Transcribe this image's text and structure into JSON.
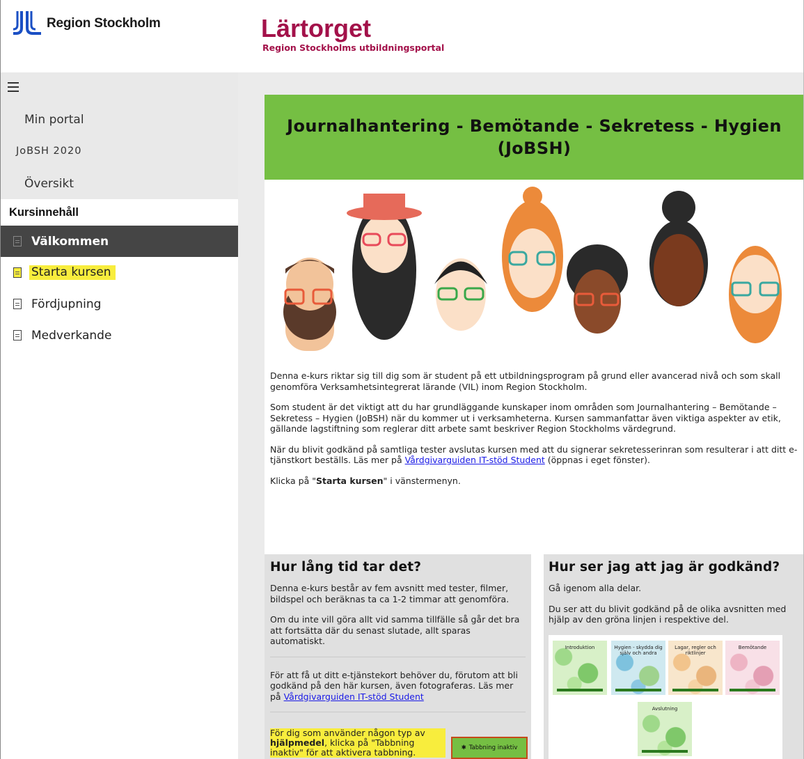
{
  "header": {
    "org_name": "Region Stockholm",
    "brand_title": "Lärtorget",
    "brand_subtitle": "Region Stockholms utbildningsportal"
  },
  "sidebar": {
    "links": {
      "portal": "Min portal",
      "course": "JoBSH 2020",
      "overview": "Översikt"
    },
    "section_title": "Kursinnehåll",
    "items": [
      {
        "label": "Välkommen",
        "state": "active"
      },
      {
        "label": "Starta kursen",
        "state": "highlighted"
      },
      {
        "label": "Fördjupning",
        "state": "normal"
      },
      {
        "label": "Medverkande",
        "state": "normal"
      }
    ]
  },
  "main": {
    "banner_title": "Journalhantering - Bemötande - Sekretess - Hygien (JoBSH)",
    "intro": {
      "p1": "Denna e-kurs riktar sig till dig som är student på ett utbildningsprogram på grund eller avancerad nivå och som skall genomföra Verksamhetsintegrerat lärande (VIL) inom Region Stockholm.",
      "p2": "Som student är det viktigt att du har grundläggande kunskaper inom områden som Journalhantering – Bemötande – Sekretess – Hygien (JoBSH) när du kommer ut i verksamheterna. Kursen sammanfattar även viktiga aspekter av etik, gällande lagstiftning som reglerar ditt arbete samt beskriver Region Stockholms värdegrund.",
      "p3_before": "När du blivit godkänd på samtliga tester avslutas kursen med att du signerar sekretesserinran som resulterar i att ditt e-tjänstkort beställs. Läs mer på ",
      "p3_link": "Vårdgivarguiden IT-stöd Student",
      "p3_after": " (öppnas i eget fönster).",
      "p4_before": "Klicka på \"",
      "p4_bold": "Starta kursen",
      "p4_after": "\" i vänstermenyn."
    },
    "box_left": {
      "title": "Hur lång tid tar det?",
      "p1": "Denna e-kurs består av fem avsnitt med tester, filmer, bildspel och beräknas ta ca 1-2 timmar att genomföra.",
      "p2": "Om du inte vill göra allt vid samma tillfälle så går det bra att fortsätta där du senast slutade, allt sparas automatiskt.",
      "p3_before": "För att få ut ditt e-tjänstekort behöver du, förutom att bli godkänd på den här kursen, även fotograferas. Läs mer på ",
      "p3_link": "Vårdgivarguiden IT-stöd Student",
      "note_before": "För dig som använder någon typ av ",
      "note_bold": "hjälpmedel",
      "note_after": ", klicka på \"Tabbning inaktiv\" för att aktivera tabbning.",
      "tab_button": "Tabbning inaktiv"
    },
    "box_right": {
      "title": "Hur ser jag att jag är godkänd?",
      "p1": "Gå igenom alla delar.",
      "p2": "Du ser att du blivit godkänd på de olika avsnitten med hjälp av den gröna linjen i respektive del.",
      "thumbs": [
        "Introduktion",
        "Hygien - skydda dig själv och andra",
        "Lagar, regler och riktlinjer",
        "Bemötande",
        "Avslutning"
      ]
    }
  },
  "colors": {
    "brand": "#a3114a",
    "banner": "#75bf43",
    "highlight": "#f8ed3d",
    "active_nav": "#454545"
  }
}
